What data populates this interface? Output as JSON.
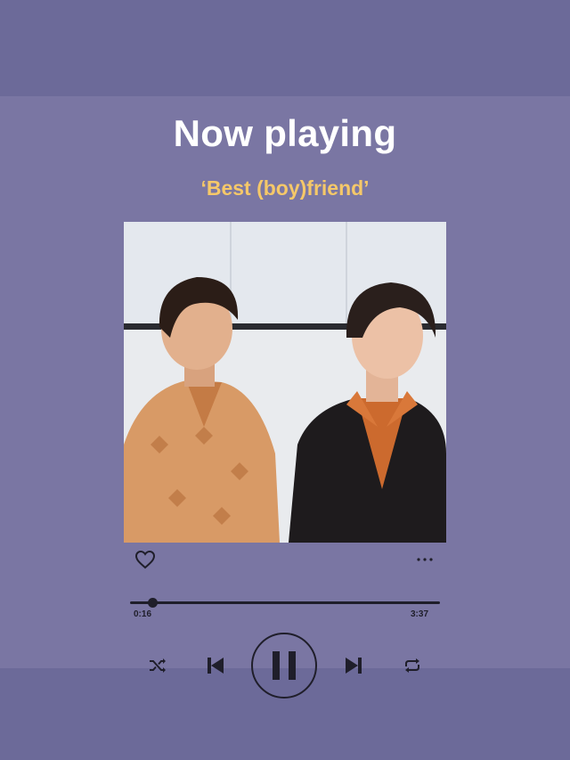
{
  "player": {
    "heading": "Now playing",
    "song_title": "‘Best (boy)friend’",
    "progress": {
      "current": "0:16",
      "duration": "3:37",
      "fraction": 0.074
    },
    "icons": {
      "like": "heart-icon",
      "more": "more-options-icon",
      "shuffle": "shuffle-icon",
      "previous": "skip-previous-icon",
      "play_pause": "pause-icon",
      "next": "skip-next-icon",
      "repeat": "repeat-icon"
    },
    "colors": {
      "background": "#7a76a3",
      "band": "#6c6a99",
      "heading": "#ffffff",
      "song_title": "#f5c869",
      "controls": "#1f1e2a"
    }
  }
}
